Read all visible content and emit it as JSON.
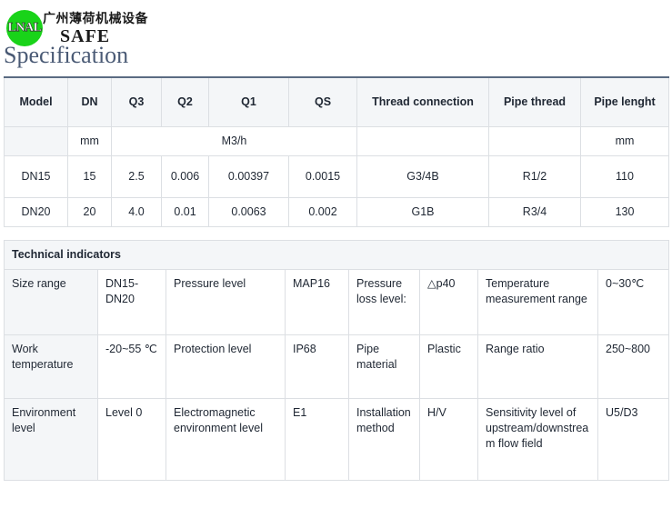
{
  "logo": {
    "mark_text": "LNAL",
    "company_cn": "广州薄荷机械设备",
    "brand": "SAFE",
    "mark_color": "#19d319"
  },
  "page_title": "Specification",
  "spec_table": {
    "headers": [
      "Model",
      "DN",
      "Q3",
      "Q2",
      "Q1",
      "QS",
      "Thread connection",
      "Pipe thread",
      "Pipe lenght"
    ],
    "unit_row": {
      "model": "",
      "dn": "mm",
      "flow_units": "M3/h",
      "thread_connection": "",
      "pipe_thread": "",
      "pipe_lenght": "mm"
    },
    "rows": [
      {
        "model": "DN15",
        "dn": "15",
        "q3": "2.5",
        "q2": "0.006",
        "q1": "0.00397",
        "qs": "0.0015",
        "thread_connection": "G3/4B",
        "pipe_thread": "R1/2",
        "pipe_lenght": "110"
      },
      {
        "model": "DN20",
        "dn": "20",
        "q3": "4.0",
        "q2": "0.01",
        "q1": "0.0063",
        "qs": "0.002",
        "thread_connection": "G1B",
        "pipe_thread": "R3/4",
        "pipe_lenght": "130"
      }
    ]
  },
  "tech_table": {
    "section_title": "Technical indicators",
    "rows": [
      {
        "c1": "Size range",
        "c2": "DN15-DN20",
        "c3": "Pressure level",
        "c4": "MAP16",
        "c5": "Pressure loss level:",
        "c6": "△p40",
        "c7": "Temperature measurement range",
        "c8": "0~30℃"
      },
      {
        "c1": "Work temperature",
        "c2": "-20~55 ℃",
        "c3": "Protection level",
        "c4": "IP68",
        "c5": "Pipe material",
        "c6": "Plastic",
        "c7": "Range ratio",
        "c8": "250~800"
      },
      {
        "c1": "Environment level",
        "c2": "Level 0",
        "c3": "Electromagnetic environment level",
        "c4": "E1",
        "c5": "Installation method",
        "c6": "H/V",
        "c7": "Sensitivity level of upstream/downstream flow field",
        "c8": "U5/D3"
      }
    ]
  }
}
